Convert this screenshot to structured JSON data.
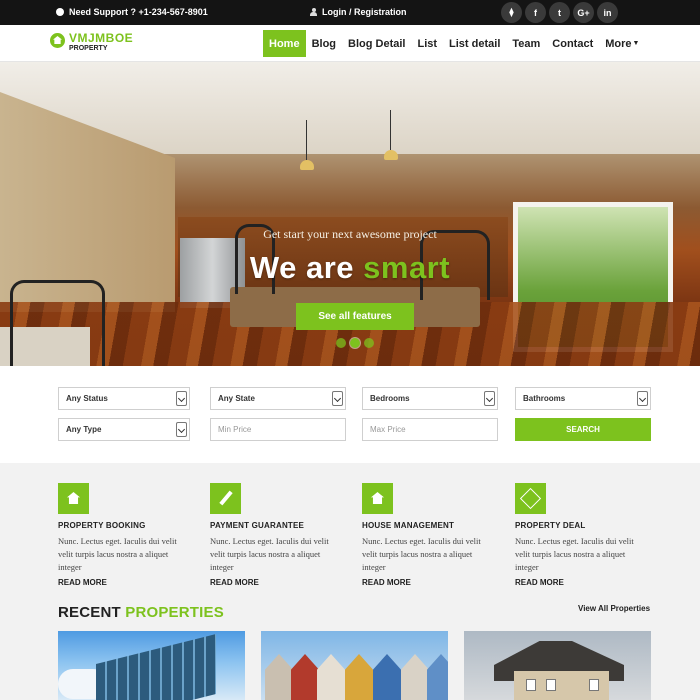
{
  "topbar": {
    "support_text": "Need Support ? +1-234-567-8901",
    "login_text": "Login / Registration",
    "socials": [
      {
        "name": "rss",
        "glyph": ")"
      },
      {
        "name": "facebook",
        "glyph": "f"
      },
      {
        "name": "twitter",
        "glyph": "t"
      },
      {
        "name": "google-plus",
        "glyph": "G+"
      },
      {
        "name": "linkedin",
        "glyph": "in"
      }
    ]
  },
  "logo": {
    "name": "VMJMBOE",
    "sub": "PROPERTY"
  },
  "nav": {
    "items": [
      "Home",
      "Blog",
      "Blog Detail",
      "List",
      "List detail",
      "Team",
      "Contact",
      "More"
    ],
    "active": "Home"
  },
  "hero": {
    "subtitle": "Get start your next awesome project",
    "title_white": "We are ",
    "title_green": "smart",
    "button": "See all features",
    "slides": 3,
    "active_slide": 2
  },
  "search": {
    "status": "Any Status",
    "state": "Any State",
    "bedrooms": "Bedrooms",
    "bathrooms": "Bathrooms",
    "type": "Any Type",
    "min_price": "Min Price",
    "max_price": "Max Price",
    "button": "SEARCH"
  },
  "features": [
    {
      "icon": "house-icon",
      "title": "PROPERTY BOOKING",
      "text": "Nunc. Lectus eget. Iaculis dui velit velit turpis lacus nostra a aliquet integer",
      "more": "READ MORE"
    },
    {
      "icon": "pencil-icon",
      "title": "PAYMENT GUARANTEE",
      "text": "Nunc. Lectus eget. Iaculis dui velit velit turpis lacus nostra a aliquet integer",
      "more": "READ MORE"
    },
    {
      "icon": "house-icon",
      "title": "HOUSE MANAGEMENT",
      "text": "Nunc. Lectus eget. Iaculis dui velit velit turpis lacus nostra a aliquet integer",
      "more": "READ MORE"
    },
    {
      "icon": "gem-icon",
      "title": "PROPERTY DEAL",
      "text": "Nunc. Lectus eget. Iaculis dui velit velit turpis lacus nostra a aliquet integer",
      "more": "READ MORE"
    }
  ],
  "recent": {
    "title_dark": "RECENT ",
    "title_green": "PROPERTIES",
    "view_all": "View All Properties"
  },
  "colors": {
    "accent": "#7dc21e",
    "topbar": "#141414"
  }
}
